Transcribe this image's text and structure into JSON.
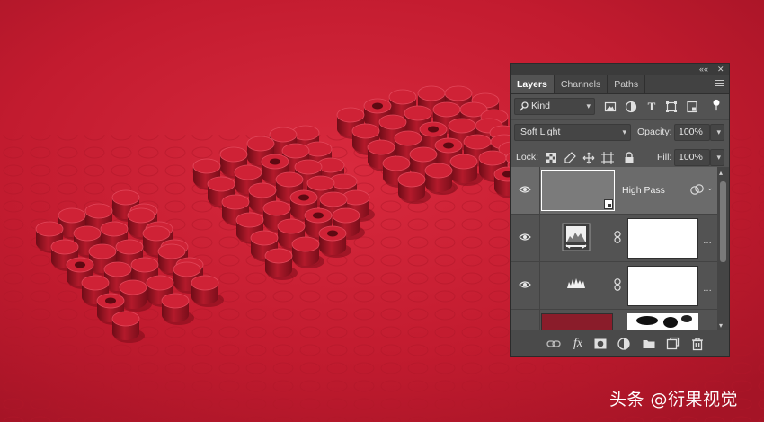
{
  "panel": {
    "top_controls": {
      "collapse": "««",
      "close": "✕"
    },
    "tabs": [
      {
        "label": "Layers",
        "active": true
      },
      {
        "label": "Channels",
        "active": false
      },
      {
        "label": "Paths",
        "active": false
      }
    ],
    "filter": {
      "value": "Kind",
      "icons": [
        "image-filter-icon",
        "adjustment-filter-icon",
        "type-filter-icon",
        "shape-filter-icon",
        "smart-object-filter-icon",
        "filter-toggle-icon"
      ]
    },
    "blend_mode": "Soft Light",
    "opacity": {
      "label": "Opacity:",
      "value": "100%"
    },
    "lock": {
      "label": "Lock:",
      "icons": [
        "lock-transparent-icon",
        "lock-paint-icon",
        "lock-position-icon",
        "lock-artboard-icon",
        "lock-all-icon"
      ]
    },
    "fill": {
      "label": "Fill:",
      "value": "100%"
    },
    "layers": [
      {
        "name": "High Pass",
        "selected": true,
        "type": "smart-filter-layer"
      },
      {
        "name": "",
        "selected": false,
        "type": "levels-adjustment"
      },
      {
        "name": "",
        "selected": false,
        "type": "curves-adjustment"
      },
      {
        "name": "",
        "selected": false,
        "type": "partial"
      }
    ],
    "bottom_icons": [
      "link-layers-icon",
      "fx-icon",
      "add-mask-icon",
      "new-adjustment-icon",
      "new-group-icon",
      "new-layer-icon",
      "trash-icon"
    ],
    "bottom_fx_label": "fx"
  },
  "watermark": "头条 @衍果视觉",
  "colors": {
    "background_red": "#c41c30",
    "panel_bg": "#535353",
    "selected_layer": "#6b6b6b",
    "accent_red_thumb": "#8a1c2a"
  }
}
